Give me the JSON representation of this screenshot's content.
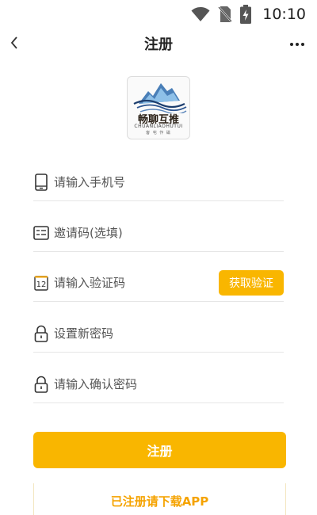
{
  "status_bar": {
    "time": "10:10",
    "icons": [
      "wifi-icon",
      "no-sim-icon",
      "battery-charging-icon"
    ]
  },
  "nav": {
    "title": "注册",
    "back_icon": "chevron-left-icon",
    "more_icon": "more-horizontal-icon"
  },
  "logo": {
    "name": "畅聊互推",
    "subtitle": "CHUANLIAOHUTUI",
    "tagline": "客 宅 作 磁"
  },
  "form": {
    "phone": {
      "placeholder": "请输入手机号",
      "value": "",
      "icon": "phone-icon"
    },
    "invite": {
      "placeholder": "邀请码(选填)",
      "value": "",
      "icon": "id-card-icon"
    },
    "code": {
      "placeholder": "请输入验证码",
      "value": "",
      "icon": "calendar-12-icon",
      "badge": "12",
      "button_label": "获取验证"
    },
    "password": {
      "placeholder": "设置新密码",
      "value": "",
      "icon": "lock-icon"
    },
    "confirm_password": {
      "placeholder": "请输入确认密码",
      "value": "",
      "icon": "lock-icon"
    }
  },
  "actions": {
    "register_label": "注册",
    "download_label": "已注册请下载APP"
  },
  "colors": {
    "accent": "#f9b600",
    "link": "#f5a300",
    "divider": "#e6e6e6"
  }
}
